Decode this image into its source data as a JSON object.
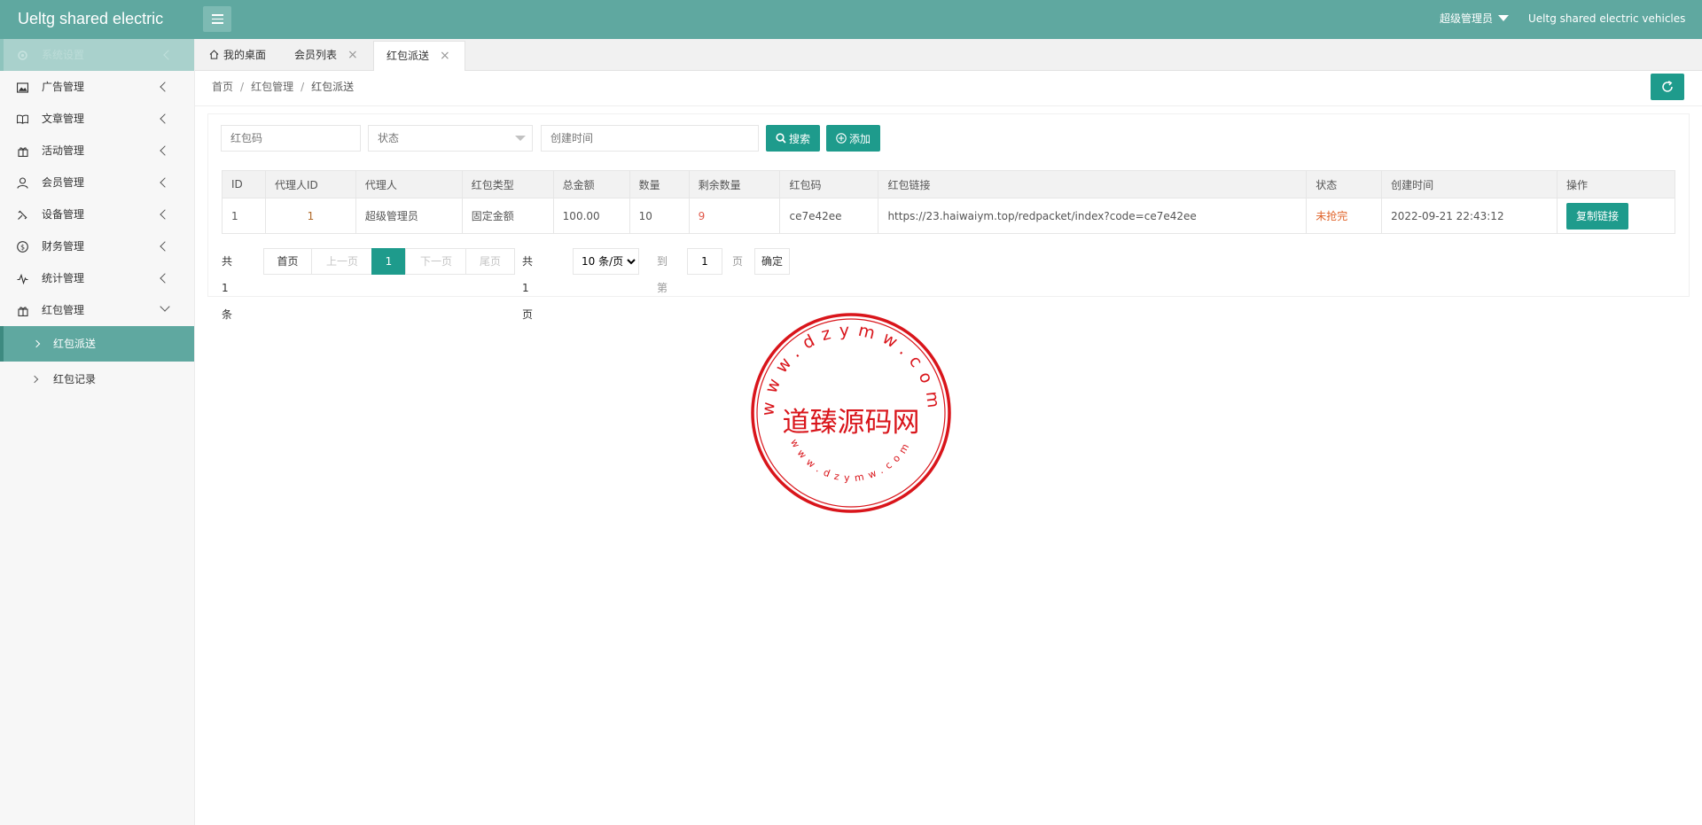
{
  "header": {
    "logo": "Ueltg shared electric",
    "user": "超级管理员",
    "brand": "Ueltg shared electric vehicles"
  },
  "sidebar": {
    "items": [
      {
        "label": "系统设置",
        "icon": "gear-icon"
      },
      {
        "label": "广告管理",
        "icon": "image-icon"
      },
      {
        "label": "文章管理",
        "icon": "book-icon"
      },
      {
        "label": "活动管理",
        "icon": "gift-icon"
      },
      {
        "label": "会员管理",
        "icon": "user-icon"
      },
      {
        "label": "设备管理",
        "icon": "tools-icon"
      },
      {
        "label": "财务管理",
        "icon": "dollar-icon"
      },
      {
        "label": "统计管理",
        "icon": "pulse-icon"
      },
      {
        "label": "红包管理",
        "icon": "gift-icon"
      }
    ],
    "subitems": [
      {
        "label": "红包派送",
        "active": true
      },
      {
        "label": "红包记录",
        "active": false
      }
    ]
  },
  "tabs": [
    {
      "label": "我的桌面"
    },
    {
      "label": "会员列表"
    },
    {
      "label": "红包派送"
    }
  ],
  "breadcrumb": [
    "首页",
    "红包管理",
    "红包派送"
  ],
  "filters": {
    "code_placeholder": "红包码",
    "status_placeholder": "状态",
    "time_placeholder": "创建时间",
    "search_label": "搜索",
    "add_label": "添加"
  },
  "table": {
    "headers": [
      "ID",
      "代理人ID",
      "代理人",
      "红包类型",
      "总金额",
      "数量",
      "剩余数量",
      "红包码",
      "红包链接",
      "状态",
      "创建时间",
      "操作"
    ],
    "rows": [
      {
        "id": "1",
        "agent_id": "1",
        "agent": "超级管理员",
        "type": "固定金额",
        "total": "100.00",
        "count": "10",
        "remaining": "9",
        "code": "ce7e42ee",
        "link": "https://23.haiwaiym.top/redpacket/index?code=ce7e42ee",
        "status": "未抢完",
        "created": "2022-09-21 22:43:12",
        "action": "复制链接"
      }
    ]
  },
  "pagination": {
    "total_text": "共 1 条",
    "first": "首页",
    "prev": "上一页",
    "current": "1",
    "next": "下一页",
    "last": "尾页",
    "pages_text": "共 1 页",
    "per_page": "10 条/页",
    "goto_label": "到第",
    "goto_value": "1",
    "page_unit": "页",
    "confirm": "确定"
  },
  "stamp": {
    "name": "道臻源码网",
    "url_top": "www.dzymw.com",
    "url_bottom": "www.dzymw.com",
    "color": "#d9151b"
  },
  "colors": {
    "header": "#5fa8a0",
    "accent": "#1e9b8c"
  }
}
